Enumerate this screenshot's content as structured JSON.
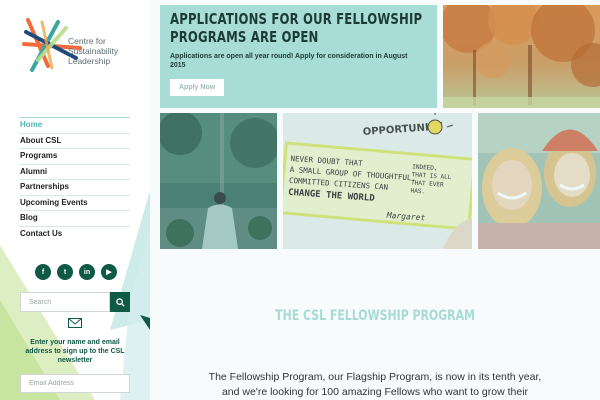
{
  "brand": {
    "name_lines": [
      "Centre for",
      "Sustainability",
      "Leadership"
    ],
    "colors": {
      "teal": "#4fb7b1",
      "dark_green": "#0f5a45",
      "mint": "#a8dcd6",
      "orange": "#f26b3a",
      "navy": "#1f4a7a"
    }
  },
  "nav": {
    "items": [
      {
        "label": "Home",
        "active": true
      },
      {
        "label": "About CSL",
        "active": false
      },
      {
        "label": "Programs",
        "active": false
      },
      {
        "label": "Alumni",
        "active": false
      },
      {
        "label": "Partnerships",
        "active": false
      },
      {
        "label": "Upcoming Events",
        "active": false
      },
      {
        "label": "Blog",
        "active": false
      },
      {
        "label": "Contact Us",
        "active": false
      }
    ]
  },
  "social": [
    {
      "icon": "facebook-icon",
      "glyph": "f"
    },
    {
      "icon": "twitter-icon",
      "glyph": "t"
    },
    {
      "icon": "linkedin-icon",
      "glyph": "in"
    },
    {
      "icon": "youtube-icon",
      "glyph": "▶"
    }
  ],
  "search": {
    "placeholder": "Search",
    "icon": "search-icon"
  },
  "newsletter": {
    "icon": "envelope-icon",
    "text": "Enter your name and email address to sign up to the CSL newsletter",
    "email_placeholder": "Email Address"
  },
  "hero": {
    "title_lines": [
      "APPLICATIONS FOR OUR FELLOWSHIP",
      "PROGRAMS ARE OPEN"
    ],
    "subtitle": "Applications are open all year round! Apply for consideration in August 2015",
    "button_label": "Apply Now"
  },
  "whiteboard": {
    "title": "OPPORTUNITY",
    "quote_lines": [
      "NEVER DOUBT THAT",
      "A SMALL GROUP OF THOUGHTFUL,",
      "COMMITTED CITIZENS CAN",
      "CHANGE THE WORLD"
    ],
    "reply_lines": [
      "INDEED,",
      "THAT IS ALL",
      "THAT EVER",
      "HAS."
    ],
    "signature": "Margaret"
  },
  "section": {
    "title": "THE CSL FELLOWSHIP PROGRAM",
    "body": "The Fellowship Program, our Flagship Program, is now in its tenth year, and we're looking for 100 amazing Fellows who want to grow their capacity to"
  }
}
